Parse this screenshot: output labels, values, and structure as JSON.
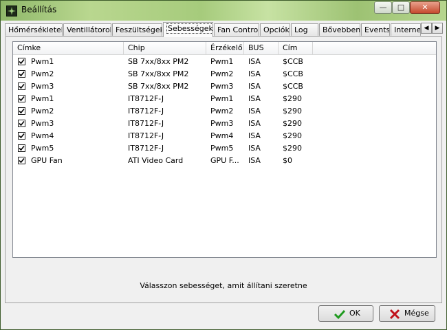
{
  "window": {
    "title": "Beállítás",
    "minimize_icon": "minimize-icon",
    "maximize_icon": "maximize-icon",
    "close_icon": "close-icon"
  },
  "tabs": [
    {
      "label": "Hőmérsékletek"
    },
    {
      "label": "Ventillátorok"
    },
    {
      "label": "Feszültségek"
    },
    {
      "label": "Sebességek",
      "active": true
    },
    {
      "label": "Fan Control"
    },
    {
      "label": "Opciók"
    },
    {
      "label": "Log"
    },
    {
      "label": "Bővebben"
    },
    {
      "label": "Events"
    },
    {
      "label": "Interne"
    }
  ],
  "list": {
    "columns": [
      "Címke",
      "Chip",
      "Érzékelő",
      "BUS",
      "Cím"
    ],
    "rows": [
      {
        "checked": true,
        "label": "Pwm1",
        "chip": "SB 7xx/8xx PM2",
        "sensor": "Pwm1",
        "bus": "ISA",
        "addr": "$CCB"
      },
      {
        "checked": true,
        "label": "Pwm2",
        "chip": "SB 7xx/8xx PM2",
        "sensor": "Pwm2",
        "bus": "ISA",
        "addr": "$CCB"
      },
      {
        "checked": true,
        "label": "Pwm3",
        "chip": "SB 7xx/8xx PM2",
        "sensor": "Pwm3",
        "bus": "ISA",
        "addr": "$CCB"
      },
      {
        "checked": true,
        "label": "Pwm1",
        "chip": "IT8712F-J",
        "sensor": "Pwm1",
        "bus": "ISA",
        "addr": "$290"
      },
      {
        "checked": true,
        "label": "Pwm2",
        "chip": "IT8712F-J",
        "sensor": "Pwm2",
        "bus": "ISA",
        "addr": "$290"
      },
      {
        "checked": true,
        "label": "Pwm3",
        "chip": "IT8712F-J",
        "sensor": "Pwm3",
        "bus": "ISA",
        "addr": "$290"
      },
      {
        "checked": true,
        "label": "Pwm4",
        "chip": "IT8712F-J",
        "sensor": "Pwm4",
        "bus": "ISA",
        "addr": "$290"
      },
      {
        "checked": true,
        "label": "Pwm5",
        "chip": "IT8712F-J",
        "sensor": "Pwm5",
        "bus": "ISA",
        "addr": "$290"
      },
      {
        "checked": true,
        "label": "GPU Fan",
        "chip": "ATI Video Card",
        "sensor": "GPU F...",
        "bus": "ISA",
        "addr": "$0"
      }
    ]
  },
  "status_text": "Válasszon sebességet, amit állítani szeretne",
  "buttons": {
    "ok": "OK",
    "cancel": "Mégse"
  },
  "colors": {
    "ok_check": "#1f9a1f",
    "cancel_x": "#c0101a"
  }
}
